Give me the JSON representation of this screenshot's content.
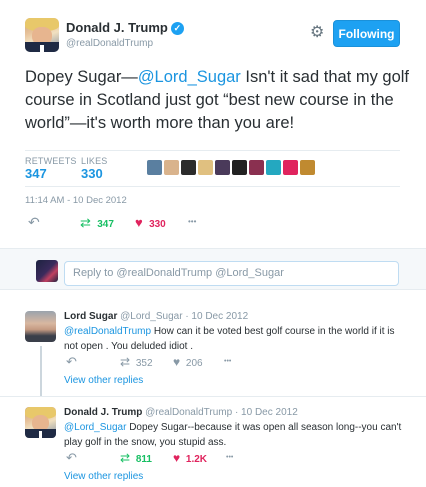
{
  "header": {
    "name": "Donald J. Trump",
    "handle": "@realDonaldTrump",
    "follow_label": "Following",
    "verified_glyph": "✓",
    "icons": {
      "verified": "verified-badge-icon",
      "settings": "gear-icon"
    }
  },
  "main_tweet": {
    "text_prefix": "Dopey Sugar—",
    "mention": "@Lord_Sugar",
    "text_rest": "  Isn't it sad that my golf course in Scotland just got “best new course in the world”—it's worth more than you are!",
    "retweets_label": "RETWEETS",
    "retweets_value": "347",
    "likes_label": "LIKES",
    "likes_value": "330",
    "timestamp": "11:14 AM - 10 Dec 2012",
    "actions": {
      "retweet_count": "347",
      "like_count": "330"
    },
    "liker_avatar_colors": [
      "#5a7fa0",
      "#d9b38c",
      "#2b2b2b",
      "#e0c080",
      "#4a3a5a",
      "#222222",
      "#8a3050",
      "#24a8c0",
      "#e0245e",
      "#c08a30"
    ]
  },
  "reply_box": {
    "placeholder": "Reply to @realDonaldTrump @Lord_Sugar"
  },
  "replies": [
    {
      "name": "Lord Sugar",
      "handle": "@Lord_Sugar",
      "date": "· 10 Dec 2012",
      "mention": "@realDonaldTrump",
      "text": " How can it be voted best golf course in the world if it is not open . You deluded idiot .",
      "retweet_count": "352",
      "like_count": "206",
      "view_other": "View other replies"
    },
    {
      "name": "Donald J. Trump",
      "handle": "@realDonaldTrump",
      "date": "· 10 Dec 2012",
      "mention": "@Lord_Sugar",
      "text": " Dopey Sugar--because it was open all season long--you can't play golf in the snow, you stupid ass.",
      "retweet_count": "811",
      "like_count": "1.2K",
      "view_other": "View other replies"
    }
  ],
  "glyphs": {
    "reply": "↶",
    "retweet": "⇄",
    "like": "♥",
    "more": "•••",
    "gear": "⚙"
  },
  "colors": {
    "accent": "#1da1f2",
    "retweet": "#17bf63",
    "like": "#e0245e"
  }
}
